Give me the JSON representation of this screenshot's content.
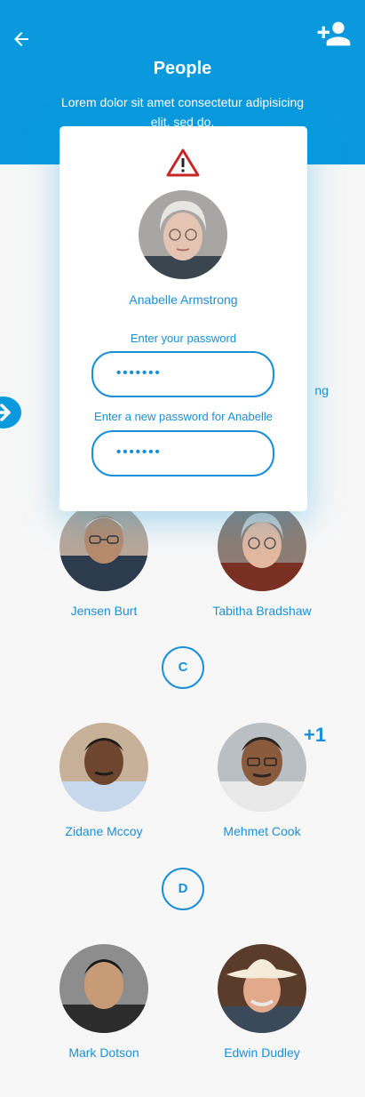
{
  "header": {
    "title": "People",
    "subtitle": "Lorem dolor sit amet consectetur adipisicing elit, sed do.",
    "back_icon": "arrow-left-icon",
    "add_icon": "add-user-icon"
  },
  "background_partial_name": "ng",
  "people": [
    {
      "name": "Jensen Burt"
    },
    {
      "name": "Tabitha Bradshaw"
    },
    {
      "name": "Zidane Mccoy"
    },
    {
      "name": "Mehmet Cook"
    },
    {
      "name": "Mark Dotson"
    },
    {
      "name": "Edwin Dudley"
    }
  ],
  "sections": [
    "C",
    "D"
  ],
  "extra_badge": "+1",
  "modal": {
    "warning_icon": "warning-icon",
    "name": "Anabelle Armstrong",
    "password_label": "Enter your password",
    "password_value": "•••••••",
    "new_password_label": "Enter a new password for Anabelle",
    "new_password_value": "•••••••"
  },
  "colors": {
    "accent": "#0999dc",
    "text_blue": "#1a8fd8",
    "warning": "#c62828"
  }
}
